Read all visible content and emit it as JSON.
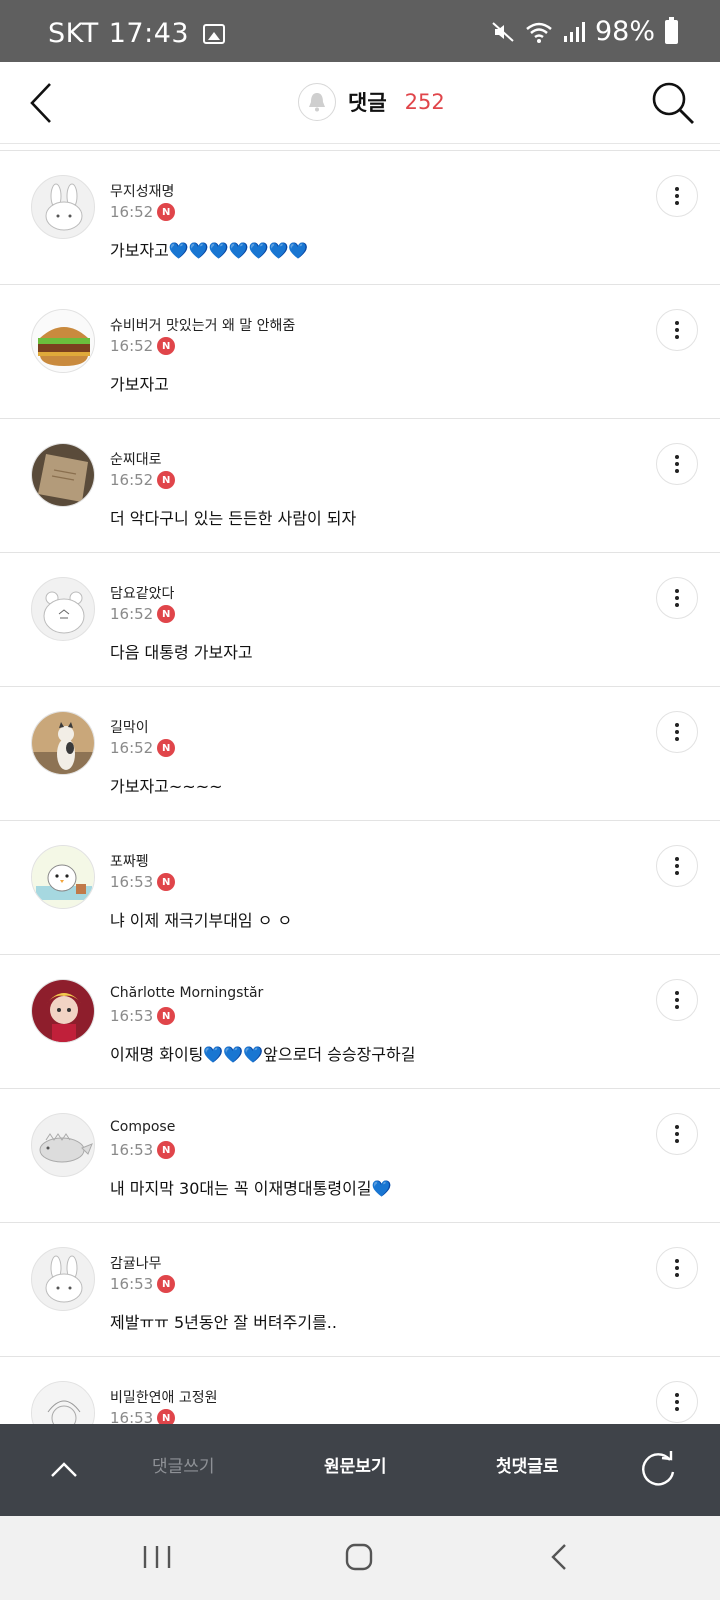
{
  "status_bar": {
    "carrier": "SKT",
    "time": "17:43",
    "battery": "98%"
  },
  "header": {
    "title": "댓글",
    "count": "252",
    "back_icon": "chevron-left-icon",
    "search_icon": "search-icon",
    "bell_icon": "bell-icon"
  },
  "comments": [
    {
      "author": "무지성재명",
      "time": "16:52",
      "badge": "N",
      "text": "가보자고💙💙💙💙💙💙💙"
    },
    {
      "author": "슈비버거 맛있는거 왜 말 안해줌",
      "time": "16:52",
      "badge": "N",
      "text": "가보자고"
    },
    {
      "author": "순찌대로",
      "time": "16:52",
      "badge": "N",
      "text": "더 악다구니 있는 든든한 사람이 되자"
    },
    {
      "author": "담요같았다",
      "time": "16:52",
      "badge": "N",
      "text": "다음 대통령 가보자고"
    },
    {
      "author": "길막이",
      "time": "16:52",
      "badge": "N",
      "text": "가보자고~~~~"
    },
    {
      "author": "포짜펭",
      "time": "16:53",
      "badge": "N",
      "text": "냐 이제 재극기부대임 ㅇ ㅇ"
    },
    {
      "author": "Chărlotte Morningstăr",
      "time": "16:53",
      "badge": "N",
      "text": "이재명 화이팅💙💙💙앞으로더 승승장구하길"
    },
    {
      "author": "Compose",
      "time": "16:53",
      "badge": "N",
      "text": "내 마지막 30대는 꼭 이재명대통령이길💙"
    },
    {
      "author": "감귤나무",
      "time": "16:53",
      "badge": "N",
      "text": "제발ㅠㅠ 5년동안 잘 버텨주기를.."
    },
    {
      "author": "비밀한연애 고정원",
      "time": "16:53",
      "badge": "N",
      "text": ""
    }
  ],
  "bottom_bar": {
    "write": "댓글쓰기",
    "original": "원문보기",
    "first": "첫댓글로"
  },
  "colors": {
    "accent": "#e0454a",
    "status_bar": "#5f5f5f",
    "bottom_bar": "#3f4349",
    "nav_bar": "#f1f1f1"
  }
}
